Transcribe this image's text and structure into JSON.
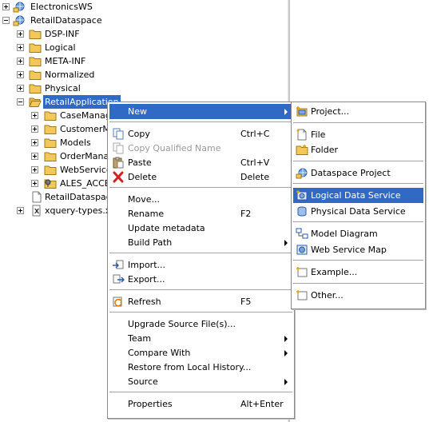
{
  "tree": {
    "items": [
      {
        "label": "ElectronicsWS",
        "icon": "web-service-project-icon",
        "expander": "plus"
      },
      {
        "label": "RetailDataspace",
        "icon": "dataspace-project-icon",
        "expander": "minus"
      },
      {
        "label": "DSP-INF",
        "icon": "folder-icon",
        "expander": "plus"
      },
      {
        "label": "Logical",
        "icon": "folder-icon",
        "expander": "plus"
      },
      {
        "label": "META-INF",
        "icon": "folder-icon",
        "expander": "plus"
      },
      {
        "label": "Normalized",
        "icon": "folder-icon",
        "expander": "plus"
      },
      {
        "label": "Physical",
        "icon": "folder-icon",
        "expander": "plus"
      },
      {
        "label": "RetailApplication",
        "icon": "folder-open-icon",
        "expander": "minus"
      },
      {
        "label": "CaseManag",
        "icon": "folder-icon",
        "expander": "plus"
      },
      {
        "label": "CustomerMa",
        "icon": "folder-icon",
        "expander": "plus"
      },
      {
        "label": "Models",
        "icon": "folder-icon",
        "expander": "plus"
      },
      {
        "label": "OrderManag",
        "icon": "folder-icon",
        "expander": "plus"
      },
      {
        "label": "WebServices",
        "icon": "folder-icon",
        "expander": "plus"
      },
      {
        "label": "ALES_ACCES",
        "icon": "security-folder-icon",
        "expander": "plus"
      },
      {
        "label": "RetailDataspace",
        "icon": "file-icon",
        "expander": "none"
      },
      {
        "label": "xquery-types.xs",
        "icon": "xsd-file-icon",
        "expander": "plus"
      }
    ]
  },
  "context_menu": {
    "items": [
      {
        "type": "item",
        "label": "New",
        "submenu": true,
        "highlighted": true
      },
      {
        "type": "sep"
      },
      {
        "type": "item",
        "label": "Copy",
        "shortcut": "Ctrl+C",
        "icon": "copy-icon"
      },
      {
        "type": "item",
        "label": "Copy Qualified Name",
        "disabled": true,
        "icon": "copy-qualified-name-icon"
      },
      {
        "type": "item",
        "label": "Paste",
        "shortcut": "Ctrl+V",
        "icon": "paste-icon"
      },
      {
        "type": "item",
        "label": "Delete",
        "shortcut": "Delete",
        "icon": "delete-icon"
      },
      {
        "type": "sep"
      },
      {
        "type": "item",
        "label": "Move..."
      },
      {
        "type": "item",
        "label": "Rename",
        "shortcut": "F2"
      },
      {
        "type": "item",
        "label": "Update metadata"
      },
      {
        "type": "item",
        "label": "Build Path",
        "submenu": true
      },
      {
        "type": "sep"
      },
      {
        "type": "item",
        "label": "Import...",
        "icon": "import-icon"
      },
      {
        "type": "item",
        "label": "Export...",
        "icon": "export-icon"
      },
      {
        "type": "sep"
      },
      {
        "type": "item",
        "label": "Refresh",
        "shortcut": "F5",
        "icon": "refresh-icon"
      },
      {
        "type": "sep"
      },
      {
        "type": "item",
        "label": "Upgrade Source File(s)..."
      },
      {
        "type": "item",
        "label": "Team",
        "submenu": true
      },
      {
        "type": "item",
        "label": "Compare With",
        "submenu": true
      },
      {
        "type": "item",
        "label": "Restore from Local History..."
      },
      {
        "type": "item",
        "label": "Source",
        "submenu": true
      },
      {
        "type": "sep"
      },
      {
        "type": "item",
        "label": "Properties",
        "shortcut": "Alt+Enter"
      }
    ]
  },
  "new_submenu": {
    "items": [
      {
        "type": "item",
        "label": "Project...",
        "icon": "new-project-icon"
      },
      {
        "type": "sep"
      },
      {
        "type": "item",
        "label": "File",
        "icon": "new-file-icon"
      },
      {
        "type": "item",
        "label": "Folder",
        "icon": "new-folder-icon"
      },
      {
        "type": "sep"
      },
      {
        "type": "item",
        "label": "Dataspace Project",
        "icon": "dataspace-project-icon"
      },
      {
        "type": "sep"
      },
      {
        "type": "item",
        "label": "Logical Data Service",
        "icon": "logical-data-service-icon",
        "highlighted": true
      },
      {
        "type": "item",
        "label": "Physical Data Service",
        "icon": "physical-data-service-icon"
      },
      {
        "type": "sep"
      },
      {
        "type": "item",
        "label": "Model Diagram",
        "icon": "model-diagram-icon"
      },
      {
        "type": "item",
        "label": "Web Service Map",
        "icon": "web-service-map-icon"
      },
      {
        "type": "sep"
      },
      {
        "type": "item",
        "label": "Example...",
        "icon": "example-icon"
      },
      {
        "type": "sep"
      },
      {
        "type": "item",
        "label": "Other...",
        "icon": "other-wizard-icon"
      }
    ]
  },
  "colors": {
    "selection": "#316ac5",
    "folder": "#f2c85b",
    "menu_border": "#8a8a8a"
  }
}
